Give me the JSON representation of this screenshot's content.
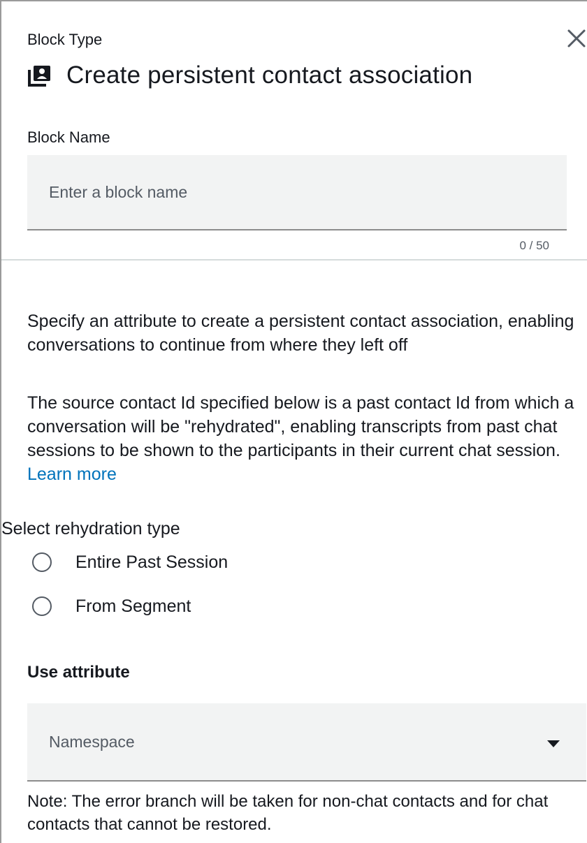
{
  "header": {
    "block_type_label": "Block Type",
    "title": "Create persistent contact association",
    "title_icon": "contact-card-icon",
    "close_icon": "close-icon"
  },
  "block_name": {
    "label": "Block Name",
    "value": "",
    "placeholder": "Enter a block name",
    "char_count": "0 / 50"
  },
  "description": {
    "paragraph1": "Specify an attribute to create a persistent contact association, enabling conversations to continue from where they left off",
    "paragraph2": "The source contact Id specified below is a past contact Id from which a conversation will be \"rehydrated\", enabling transcripts from past chat sessions to be shown to the participants in their current chat session.",
    "learn_more": "Learn more"
  },
  "rehydration": {
    "label": "Select rehydration type",
    "options": [
      {
        "label": "Entire Past Session",
        "selected": false
      },
      {
        "label": "From Segment",
        "selected": false
      }
    ]
  },
  "use_attribute": {
    "label": "Use attribute",
    "namespace_value": "Namespace",
    "dropdown_icon": "caret-down-icon"
  },
  "note": "Note: The error branch will be taken for non-chat contacts and for chat contacts that cannot be restored.",
  "colors": {
    "text": "#16191f",
    "link": "#0073bb",
    "input_bg": "#f2f3f3",
    "muted": "#545b64"
  }
}
